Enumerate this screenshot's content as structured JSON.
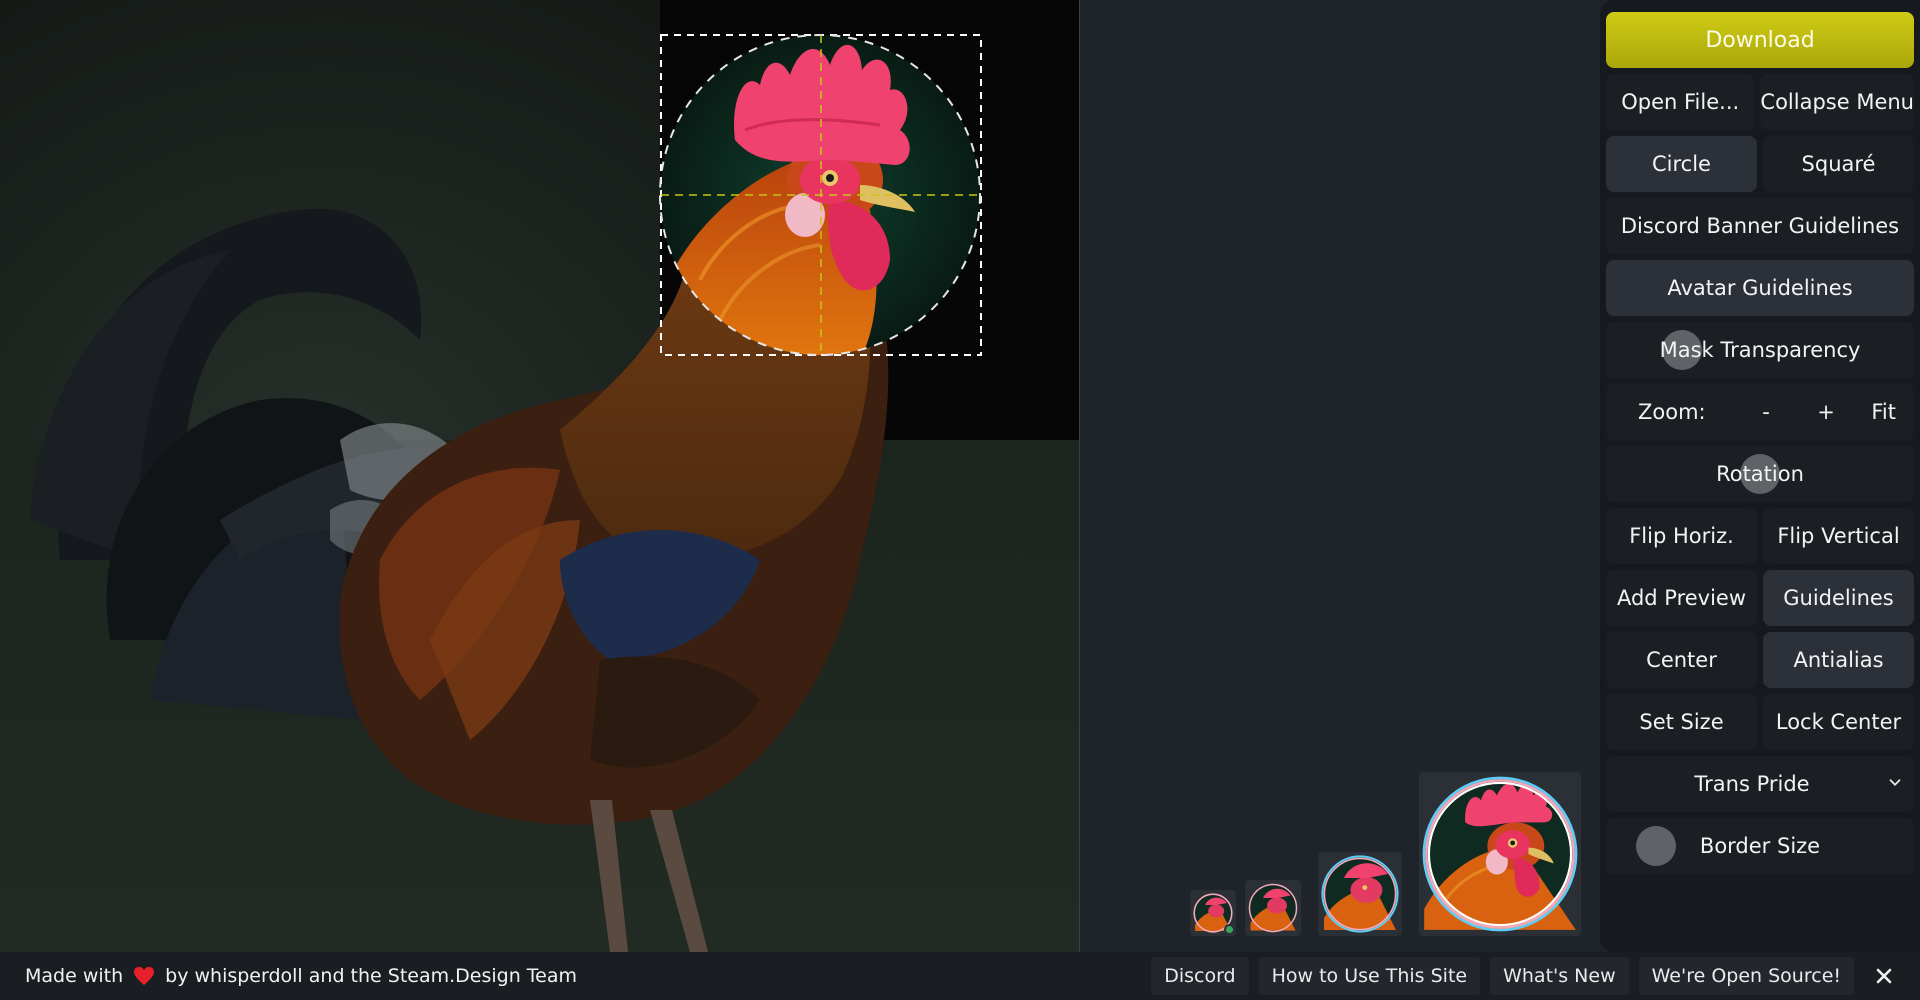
{
  "sidebar": {
    "download_label": "Download",
    "open_file_label": "Open File...",
    "collapse_menu_label": "Collapse Menu",
    "circle_label": "Circle",
    "square_label": "Squaré",
    "discord_banner_label": "Discord Banner Guidelines",
    "avatar_guidelines_label": "Avatar Guidelines",
    "mask_transparency_label": "Mask Transparency",
    "zoom": {
      "label": "Zoom:",
      "minus": "-",
      "plus": "+",
      "fit": "Fit"
    },
    "rotation_label": "Rotation",
    "flip_horiz_label": "Flip Horiz.",
    "flip_vertical_label": "Flip Vertical",
    "add_preview_label": "Add Preview",
    "guidelines_label": "Guidelines",
    "center_label": "Center",
    "antialias_label": "Antialias",
    "set_size_label": "Set Size",
    "lock_center_label": "Lock Center",
    "border_style_selected": "Trans Pride",
    "border_size_label": "Border Size"
  },
  "footer": {
    "made_with": "Made with",
    "credit": "by whisperdoll and the Steam.Design Team",
    "links": [
      "Discord",
      "How to Use This Site",
      "What's New",
      "We're Open Source!"
    ]
  },
  "colors": {
    "accent": "#c4c011",
    "heart": "#e8202a",
    "online_status": "#3ba55d",
    "ring_gradient": [
      "#5bcefa",
      "#f5a9b8",
      "#ffffff"
    ]
  },
  "icons": [
    "heart-icon",
    "close-icon",
    "chevron-down-icon"
  ]
}
